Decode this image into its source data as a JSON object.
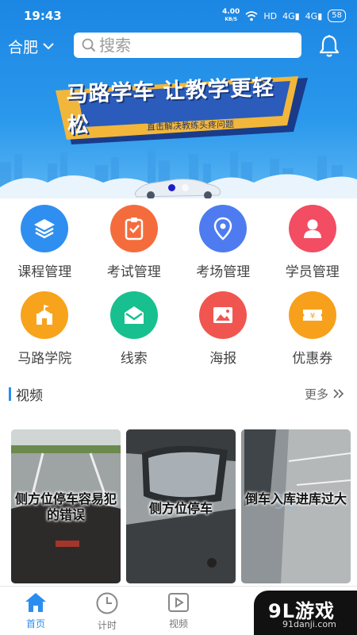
{
  "status_bar": {
    "time": "19:43",
    "net_speed": "4.00",
    "net_unit": "KB/S",
    "hd": "HD",
    "sig1": "4G",
    "sig2": "4G",
    "battery": "58"
  },
  "header": {
    "city": "合肥",
    "search_placeholder": "搜索"
  },
  "banner": {
    "title": "马路学车 让教学更轻松",
    "subtitle": "直击解决教练头疼问题"
  },
  "grid": {
    "items": [
      {
        "label": "课程管理",
        "icon": "layers-icon",
        "color": "#2f8ff0"
      },
      {
        "label": "考试管理",
        "icon": "clipboard-icon",
        "color": "#f56c3c"
      },
      {
        "label": "考场管理",
        "icon": "location-pin-icon",
        "color": "#4e7cf0"
      },
      {
        "label": "学员管理",
        "icon": "user-icon",
        "color": "#f24d63"
      },
      {
        "label": "马路学院",
        "icon": "school-icon",
        "color": "#f7a31c"
      },
      {
        "label": "线索",
        "icon": "envelope-icon",
        "color": "#19c08f"
      },
      {
        "label": "海报",
        "icon": "image-icon",
        "color": "#f0564f"
      },
      {
        "label": "优惠券",
        "icon": "coupon-icon",
        "color": "#f7a01c"
      }
    ]
  },
  "videos_section": {
    "title": "视频",
    "more": "更多",
    "items": [
      {
        "caption": "侧方位停车容易犯的错误"
      },
      {
        "caption": "侧方位停车"
      },
      {
        "caption": "倒车入库进库过大"
      }
    ]
  },
  "tabbar": {
    "tabs": [
      {
        "label": "首页",
        "icon": "home-icon"
      },
      {
        "label": "计时",
        "icon": "clock-icon"
      },
      {
        "label": "视频",
        "icon": "play-icon"
      }
    ]
  },
  "watermark": {
    "logo": "9L游戏",
    "url": "91danji.com"
  },
  "colors": {
    "accent": "#2a8ef0",
    "banner_bg": "#1c86e3"
  }
}
